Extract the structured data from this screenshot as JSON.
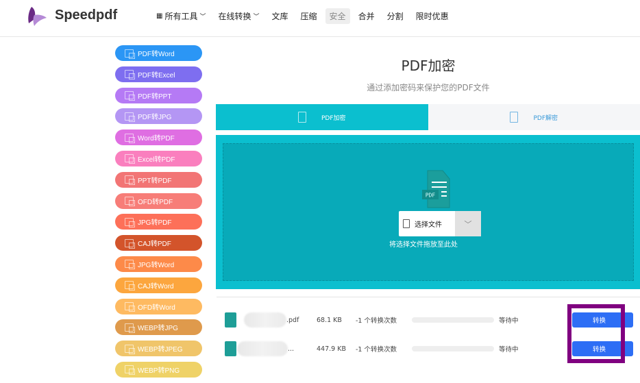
{
  "header": {
    "brand": "Speedpdf",
    "nav": [
      {
        "label": "所有工具",
        "icon": "grid-icon",
        "dropdown": true
      },
      {
        "label": "在线转换",
        "dropdown": true
      },
      {
        "label": "文库"
      },
      {
        "label": "压缩"
      },
      {
        "label": "安全",
        "active": true
      },
      {
        "label": "合并"
      },
      {
        "label": "分割"
      },
      {
        "label": "限时优惠"
      }
    ]
  },
  "sidebar": [
    {
      "label": "PDF转Word",
      "color": "#2b96f5"
    },
    {
      "label": "PDF转Excel",
      "color": "#7e6ef0"
    },
    {
      "label": "PDF转PPT",
      "color": "#b57af5"
    },
    {
      "label": "PDF转JPG",
      "color": "#b496f4"
    },
    {
      "label": "Word转PDF",
      "color": "#df6ee2"
    },
    {
      "label": "Excel转PDF",
      "color": "#fa7fbe"
    },
    {
      "label": "PPT转PDF",
      "color": "#f27575"
    },
    {
      "label": "OFD转PDF",
      "color": "#f77d78"
    },
    {
      "label": "JPG转PDF",
      "color": "#fd7059"
    },
    {
      "label": "CAJ转PDF",
      "color": "#d3542b"
    },
    {
      "label": "JPG转Word",
      "color": "#fd8a49"
    },
    {
      "label": "CAJ转Word",
      "color": "#fca63e"
    },
    {
      "label": "OFD转Word",
      "color": "#feba61"
    },
    {
      "label": "WEBP转JPG",
      "color": "#df9a4c"
    },
    {
      "label": "WEBP转JPEG",
      "color": "#f0c56a"
    },
    {
      "label": "WEBP转PNG",
      "color": "#efd267"
    }
  ],
  "main": {
    "title": "PDF加密",
    "subtitle": "通过添加密码来保护您的PDF文件",
    "tabs": [
      {
        "label": "PDF加密",
        "active": true
      },
      {
        "label": "PDF解密"
      }
    ],
    "dropzone": {
      "file_badge": "PDF",
      "pick_label": "选择文件",
      "hint": "将选择文件拖放至此处"
    },
    "files": [
      {
        "name_suffix": ".pdf",
        "size": "68.1 KB",
        "count": "-1 个转换次数",
        "progress": 0,
        "status": "等待中",
        "button": "转换"
      },
      {
        "name_suffix": "...",
        "size": "447.9 KB",
        "count": "-1 个转换次数",
        "progress": 0,
        "status": "等待中",
        "button": "转换"
      }
    ]
  },
  "annotation_color": "#800080"
}
